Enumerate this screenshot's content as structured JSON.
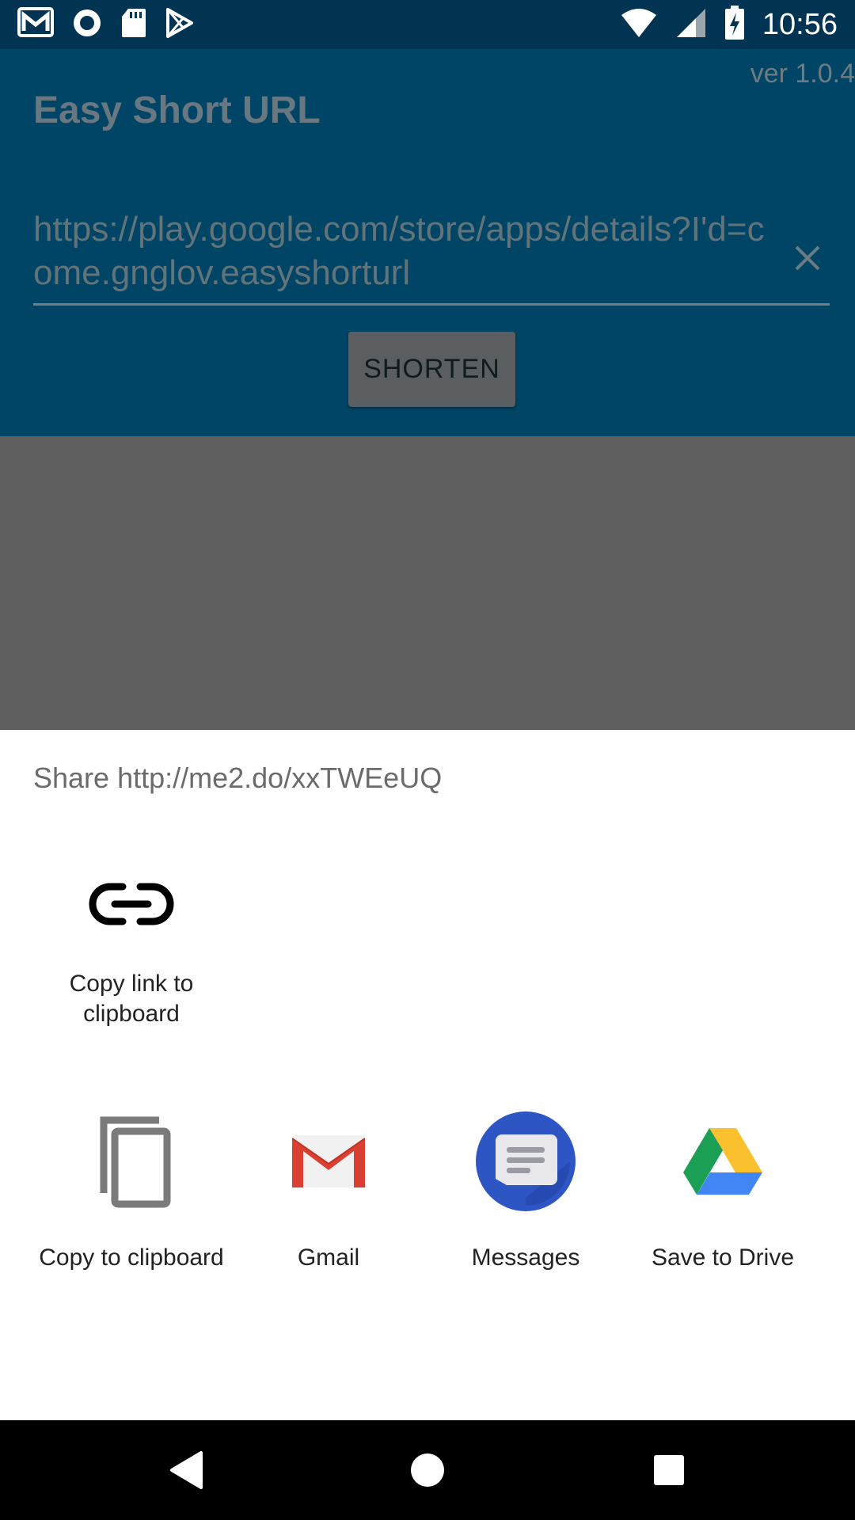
{
  "status_bar": {
    "time": "10:56",
    "left_icons": [
      "gmail-notification-icon",
      "record-icon",
      "sd-card-icon",
      "play-store-icon"
    ],
    "right_icons": [
      "wifi-icon",
      "signal-icon",
      "battery-charging-icon"
    ]
  },
  "app": {
    "version": "ver 1.0.4",
    "title": "Easy Short URL",
    "url_value": "https://play.google.com/store/apps/details?I'd=come.gnglov.easyshorturl",
    "shorten_label": "SHORTEN"
  },
  "share_sheet": {
    "title": "Share http://me2.do/xxTWEeUQ",
    "direct_targets": [
      {
        "label": "Copy link to clipboard",
        "icon": "link-icon"
      }
    ],
    "apps": [
      {
        "label": "Copy to clipboard",
        "icon": "copy-icon"
      },
      {
        "label": "Gmail",
        "icon": "gmail-icon"
      },
      {
        "label": "Messages",
        "icon": "messages-icon"
      },
      {
        "label": "Save to Drive",
        "icon": "drive-icon"
      }
    ]
  },
  "nav_bar": {
    "buttons": [
      "back-icon",
      "home-icon",
      "recents-icon"
    ]
  },
  "colors": {
    "status_bar": "#013352",
    "app_background_dimmed": "#004566",
    "scrim": "#5f5f5f",
    "sheet": "#ffffff",
    "messages_blue": "#2e55c4",
    "gmail_red": "#d93f32"
  }
}
